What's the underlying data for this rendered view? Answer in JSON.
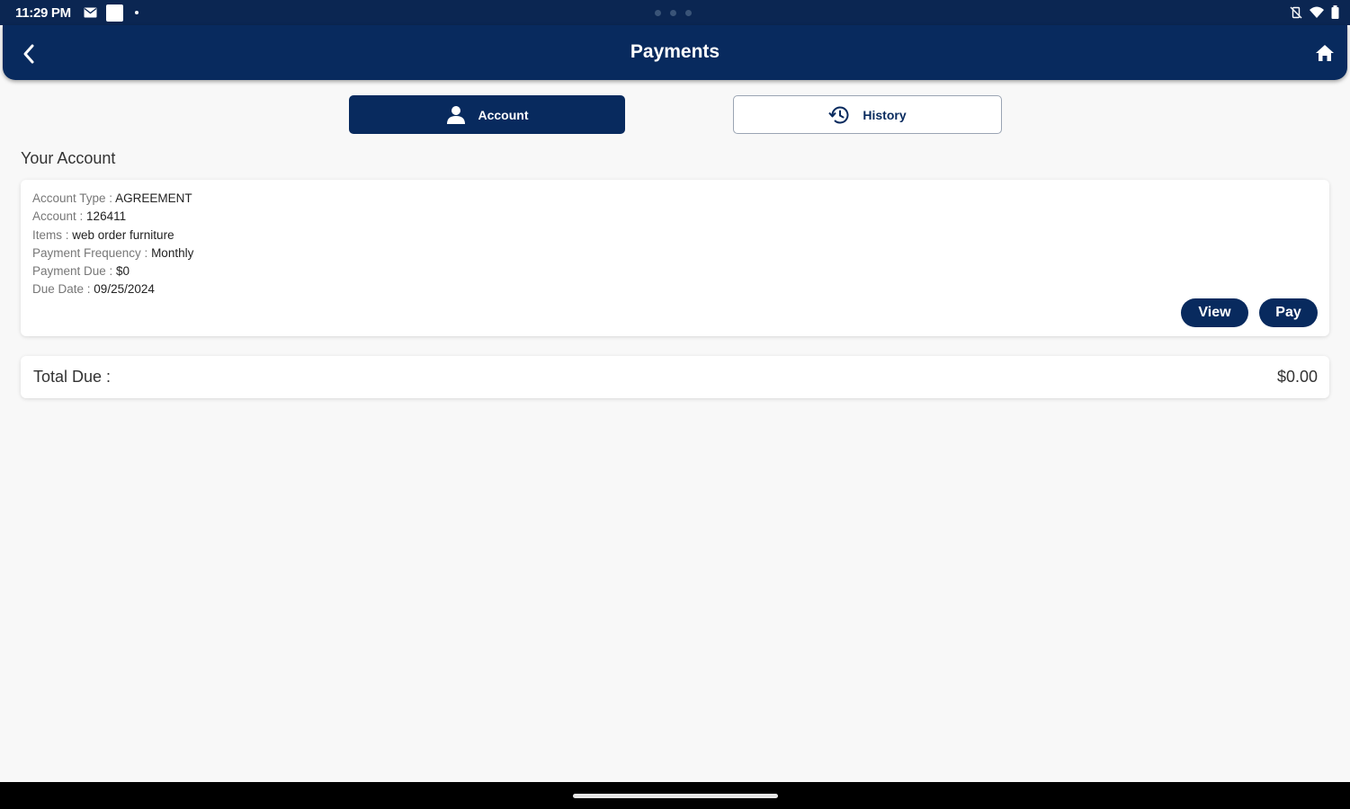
{
  "status_bar": {
    "time": "11:29 PM",
    "left_icons": [
      "mail-icon",
      "square-icon",
      "dot-icon"
    ],
    "right_icons": [
      "vibrate-off-icon",
      "wifi-icon",
      "battery-icon"
    ]
  },
  "header": {
    "title": "Payments",
    "back_icon": "chevron-left-icon",
    "home_icon": "home-icon"
  },
  "tabs": [
    {
      "label": "Account",
      "icon": "person-icon",
      "active": true
    },
    {
      "label": "History",
      "icon": "history-icon",
      "active": false
    }
  ],
  "section_title": "Your Account",
  "account": {
    "details": [
      {
        "label": "Account Type : ",
        "value": "AGREEMENT"
      },
      {
        "label": "Account : ",
        "value": "126411"
      },
      {
        "label": "Items : ",
        "value": "web order furniture"
      },
      {
        "label": "Payment Frequency : ",
        "value": "Monthly"
      },
      {
        "label": "Payment Due : ",
        "value": "$0"
      },
      {
        "label": "Due Date : ",
        "value": "09/25/2024"
      }
    ],
    "view_label": "View",
    "pay_label": "Pay"
  },
  "total": {
    "label": "Total Due :",
    "value": "$0.00"
  },
  "colors": {
    "primary": "#082a5e",
    "background": "#f8f8f8"
  }
}
